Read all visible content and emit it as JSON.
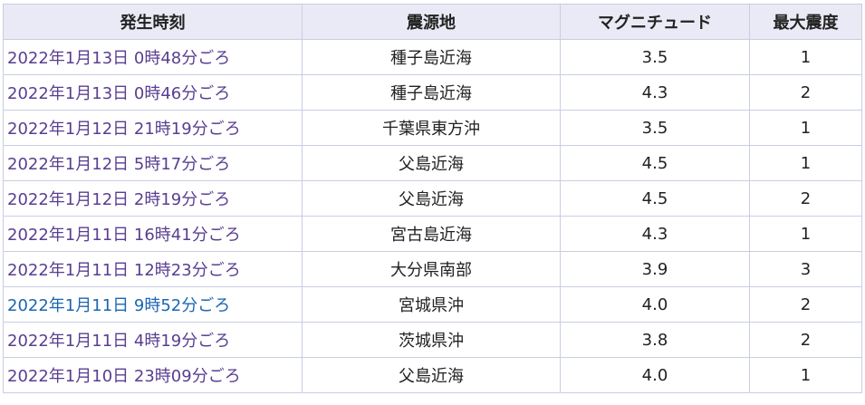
{
  "table": {
    "headers": {
      "time": "発生時刻",
      "epicenter": "震源地",
      "magnitude": "マグニチュード",
      "intensity": "最大震度"
    },
    "rows": [
      {
        "time": "2022年1月13日 0時48分ごろ",
        "epicenter": "種子島近海",
        "magnitude": "3.5",
        "intensity": "1",
        "visited": true
      },
      {
        "time": "2022年1月13日 0時46分ごろ",
        "epicenter": "種子島近海",
        "magnitude": "4.3",
        "intensity": "2",
        "visited": true
      },
      {
        "time": "2022年1月12日 21時19分ごろ",
        "epicenter": "千葉県東方沖",
        "magnitude": "3.5",
        "intensity": "1",
        "visited": true
      },
      {
        "time": "2022年1月12日 5時17分ごろ",
        "epicenter": "父島近海",
        "magnitude": "4.5",
        "intensity": "1",
        "visited": true
      },
      {
        "time": "2022年1月12日 2時19分ごろ",
        "epicenter": "父島近海",
        "magnitude": "4.5",
        "intensity": "2",
        "visited": true
      },
      {
        "time": "2022年1月11日 16時41分ごろ",
        "epicenter": "宮古島近海",
        "magnitude": "4.3",
        "intensity": "1",
        "visited": true
      },
      {
        "time": "2022年1月11日 12時23分ごろ",
        "epicenter": "大分県南部",
        "magnitude": "3.9",
        "intensity": "3",
        "visited": true
      },
      {
        "time": "2022年1月11日 9時52分ごろ",
        "epicenter": "宮城県沖",
        "magnitude": "4.0",
        "intensity": "2",
        "visited": false
      },
      {
        "time": "2022年1月11日 4時19分ごろ",
        "epicenter": "茨城県沖",
        "magnitude": "3.8",
        "intensity": "2",
        "visited": true
      },
      {
        "time": "2022年1月10日 23時09分ごろ",
        "epicenter": "父島近海",
        "magnitude": "4.0",
        "intensity": "1",
        "visited": true
      }
    ]
  },
  "colors": {
    "visited_link": "#5a3e91",
    "unvisited_link": "#1a66b3",
    "header_bg": "#eaeaf6",
    "border": "#c9cde2"
  }
}
